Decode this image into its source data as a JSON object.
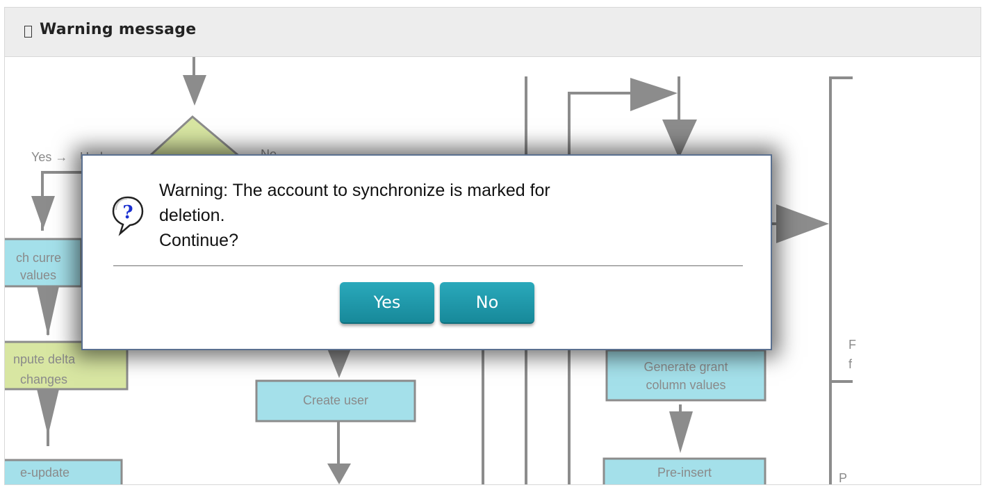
{
  "header": {
    "title": "Warning message",
    "icon": "generic-glyph-icon"
  },
  "diagram": {
    "labels": {
      "yes_branch": "Yes →",
      "update_partial": "Upda",
      "no_branch": "No",
      "fetch_current": [
        "ch curre",
        "values"
      ],
      "compute_delta": [
        "npute delta",
        "changes"
      ],
      "pre_update": "e-update",
      "create_user": "Create user",
      "generate_grant": [
        "Generate grant",
        "column values"
      ],
      "pre_insert": "Pre-insert",
      "right_partial": [
        "F",
        "f"
      ],
      "right_bottom_partial": "P"
    }
  },
  "dialog": {
    "icon": "question-speech-bubble-icon",
    "message_line1": "Warning: The account to synchronize is marked for",
    "message_line2": "deletion.",
    "message_line3": "Continue?",
    "yes_label": "Yes",
    "no_label": "No"
  },
  "colors": {
    "button": "#1f9aab",
    "cyan_box": "#a4e0ea",
    "green_box": "#d8e6a2",
    "arrow_gray": "#8c8c8c",
    "dialog_border": "#5a7090"
  }
}
